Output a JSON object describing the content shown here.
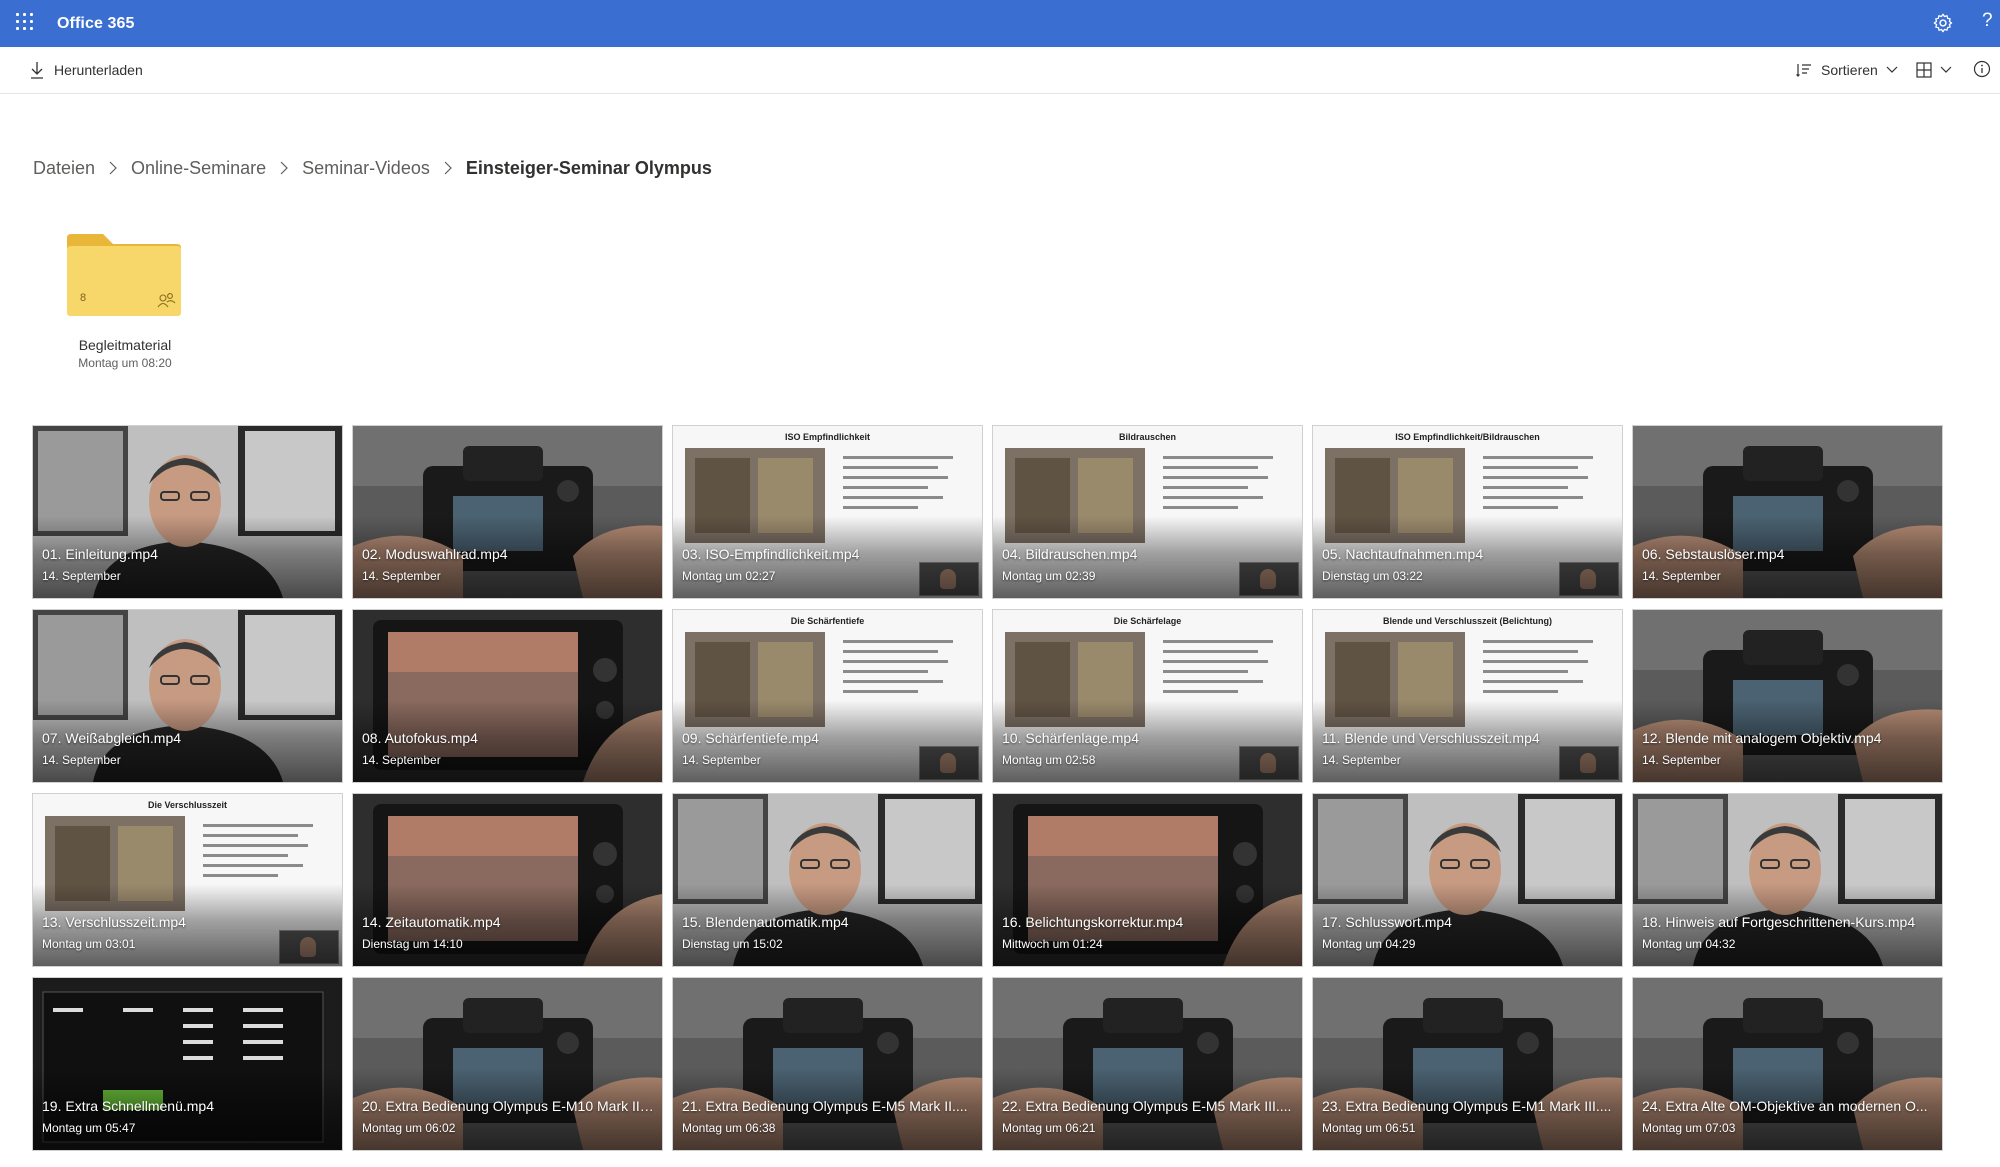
{
  "app": {
    "title": "Office 365"
  },
  "commandbar": {
    "download_label": "Herunterladen",
    "sort_label": "Sortieren"
  },
  "breadcrumb": [
    "Dateien",
    "Online-Seminare",
    "Seminar-Videos",
    "Einsteiger-Seminar Olympus"
  ],
  "folder": {
    "name": "Begleitmaterial",
    "date": "Montag um 08:20",
    "count": "8"
  },
  "videos": [
    {
      "name": "01. Einleitung.mp4",
      "date": "14. September",
      "kind": "person",
      "slide": ""
    },
    {
      "name": "02. Moduswahlrad.mp4",
      "date": "14. September",
      "kind": "camera",
      "slide": ""
    },
    {
      "name": "03. ISO-Empfindlichkeit.mp4",
      "date": "Montag um 02:27",
      "kind": "slide",
      "slide": "ISO Empfindlichkeit"
    },
    {
      "name": "04. Bildrauschen.mp4",
      "date": "Montag um 02:39",
      "kind": "slide",
      "slide": "Bildrauschen"
    },
    {
      "name": "05. Nachtaufnahmen.mp4",
      "date": "Dienstag um 03:22",
      "kind": "slide",
      "slide": "ISO Empfindlichkeit/Bildrauschen"
    },
    {
      "name": "06. Sebstauslöser.mp4",
      "date": "14. September",
      "kind": "camera",
      "slide": ""
    },
    {
      "name": "07. Weißabgleich.mp4",
      "date": "14. September",
      "kind": "person",
      "slide": ""
    },
    {
      "name": "08. Autofokus.mp4",
      "date": "14. September",
      "kind": "screen",
      "slide": ""
    },
    {
      "name": "09. Schärfentiefe.mp4",
      "date": "14. September",
      "kind": "slide",
      "slide": "Die Schärfentiefe"
    },
    {
      "name": "10. Schärfenlage.mp4",
      "date": "Montag um 02:58",
      "kind": "slide",
      "slide": "Die Schärfelage"
    },
    {
      "name": "11. Blende und Verschlusszeit.mp4",
      "date": "14. September",
      "kind": "slide",
      "slide": "Blende und Verschlusszeit (Belichtung)"
    },
    {
      "name": "12. Blende mit analogem Objektiv.mp4",
      "date": "14. September",
      "kind": "camera",
      "slide": ""
    },
    {
      "name": "13. Verschlusszeit.mp4",
      "date": "Montag um 03:01",
      "kind": "slide",
      "slide": "Die Verschlusszeit"
    },
    {
      "name": "14. Zeitautomatik.mp4",
      "date": "Dienstag um 14:10",
      "kind": "screen",
      "slide": ""
    },
    {
      "name": "15. Blendenautomatik.mp4",
      "date": "Dienstag um 15:02",
      "kind": "person",
      "slide": ""
    },
    {
      "name": "16. Belichtungskorrektur.mp4",
      "date": "Mittwoch um 01:24",
      "kind": "screen",
      "slide": ""
    },
    {
      "name": "17. Schlusswort.mp4",
      "date": "Montag um 04:29",
      "kind": "person",
      "slide": ""
    },
    {
      "name": "18. Hinweis auf Fortgeschrittenen-Kurs.mp4",
      "date": "Montag um 04:32",
      "kind": "person",
      "slide": ""
    },
    {
      "name": "19. Extra Schnellmenü.mp4",
      "date": "Montag um 05:47",
      "kind": "menu",
      "slide": ""
    },
    {
      "name": "20. Extra Bedienung Olympus E-M10 Mark II....",
      "date": "Montag um 06:02",
      "kind": "camera",
      "slide": ""
    },
    {
      "name": "21. Extra Bedienung Olympus E-M5 Mark II....",
      "date": "Montag um 06:38",
      "kind": "camera",
      "slide": ""
    },
    {
      "name": "22. Extra Bedienung Olympus E-M5 Mark III....",
      "date": "Montag um 06:21",
      "kind": "camera",
      "slide": ""
    },
    {
      "name": "23. Extra Bedienung Olympus E-M1 Mark III....",
      "date": "Montag um 06:51",
      "kind": "camera",
      "slide": ""
    },
    {
      "name": "24. Extra Alte OM-Objektive an modernen O...",
      "date": "Montag um 07:03",
      "kind": "camera",
      "slide": ""
    }
  ],
  "colors": {
    "appbar": "#3a6fd1",
    "folder": "#f5d264"
  }
}
